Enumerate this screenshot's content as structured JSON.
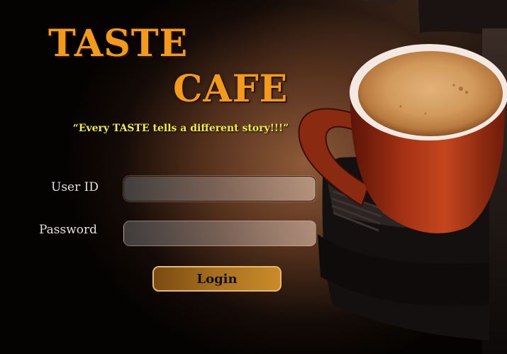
{
  "brand": {
    "title_line1": "TASTE",
    "title_line2": "CAFE",
    "tagline": "“Every TASTE tells a different story!!!”",
    "accent_color": "#f39a1a",
    "tagline_color": "#f4ef3a"
  },
  "form": {
    "user_label": "User ID",
    "user_value": "",
    "password_label": "Password",
    "password_value": "",
    "login_label": "Login",
    "button_color": "#a8701e"
  },
  "icons": {
    "background": "coffee-cup-on-espresso-machine-image"
  }
}
